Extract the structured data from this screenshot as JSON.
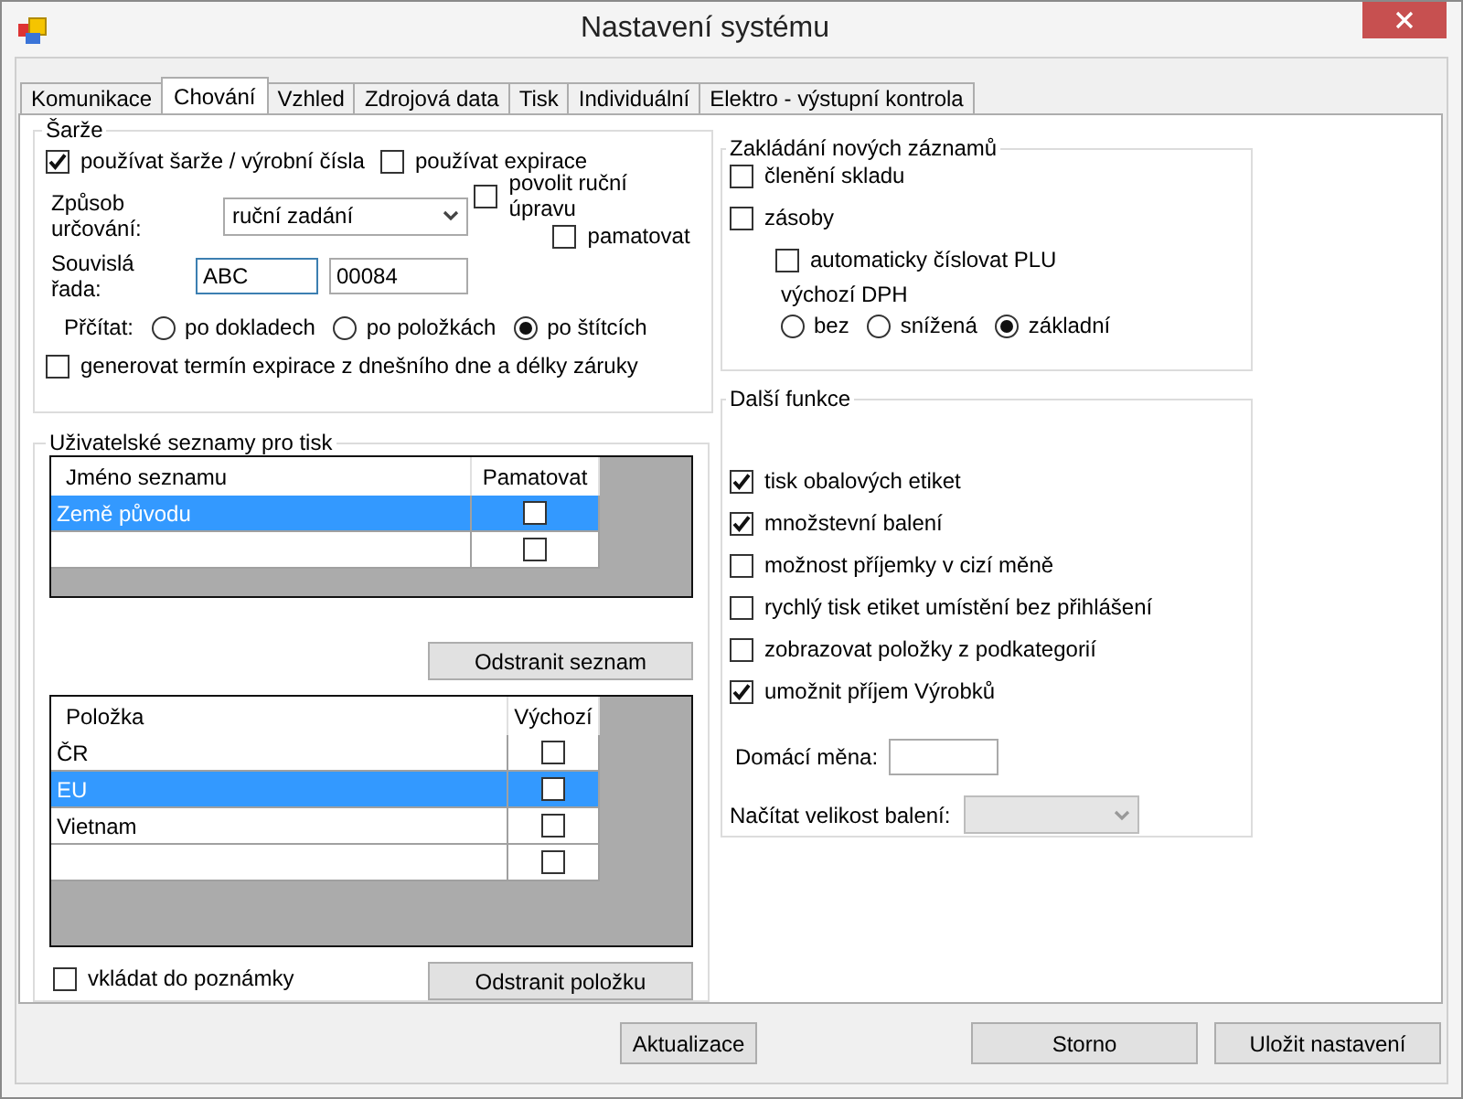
{
  "window": {
    "title": "Nastavení systému"
  },
  "tabs": [
    {
      "label": "Komunikace",
      "selected": false
    },
    {
      "label": "Chování",
      "selected": true
    },
    {
      "label": "Vzhled",
      "selected": false
    },
    {
      "label": "Zdrojová data",
      "selected": false
    },
    {
      "label": "Tisk",
      "selected": false
    },
    {
      "label": "Individuální",
      "selected": false
    },
    {
      "label": "Elektro - výstupní kontrola",
      "selected": false
    }
  ],
  "batches": {
    "title": "Šarže",
    "use_batches": {
      "label": "používat šarže / výrobní čísla",
      "checked": true
    },
    "use_expiry": {
      "label": "používat expirace",
      "checked": false
    },
    "allow_manual_edit": {
      "label": "povolit ruční úpravu",
      "checked": false
    },
    "remember": {
      "label": "pamatovat",
      "checked": false
    },
    "method": {
      "label": "Způsob určování:",
      "value": "ruční zadání"
    },
    "series": {
      "label": "Souvislá řada:",
      "prefix": "ABC",
      "number": "00084"
    },
    "count": {
      "label": "Přčítat:",
      "options": [
        {
          "label": "po dokladech",
          "selected": false
        },
        {
          "label": "po položkách",
          "selected": false
        },
        {
          "label": "po štítcích",
          "selected": true
        }
      ]
    },
    "generate_expiry": {
      "label": "generovat termín expirace z dnešního dne a délky záruky",
      "checked": false
    }
  },
  "user_lists": {
    "title": "Uživatelské seznamy pro tisk",
    "lists_table": {
      "columns": [
        "Jméno seznamu",
        "Pamatovat"
      ],
      "rows": [
        {
          "name": "Země původu",
          "checked": false,
          "selected": true
        },
        {
          "checked": false,
          "selected": false
        }
      ]
    },
    "remove_list_button": "Odstranit seznam",
    "items_table": {
      "columns": [
        "Položka",
        "Výchozí"
      ],
      "rows": [
        {
          "name": "ČR",
          "checked": false,
          "selected": false
        },
        {
          "name": "EU",
          "checked": false,
          "selected": true
        },
        {
          "name": "Vietnam",
          "checked": false,
          "selected": false
        },
        {
          "checked": false,
          "selected": false
        }
      ]
    },
    "insert_note": {
      "label": "vkládat do poznámky",
      "checked": false
    },
    "remove_item_button": "Odstranit položku"
  },
  "new_records": {
    "title": "Zakládání nových záznamů",
    "options": [
      {
        "label": "členění skladu",
        "checked": false
      },
      {
        "label": "zásoby",
        "checked": false
      }
    ],
    "auto_plu": {
      "label": "automaticky číslovat PLU",
      "checked": false
    },
    "vat": {
      "label": "výchozí DPH",
      "options": [
        {
          "label": "bez",
          "selected": false
        },
        {
          "label": "snížená",
          "selected": false
        },
        {
          "label": "základní",
          "selected": true
        }
      ]
    }
  },
  "more_functions": {
    "title": "Další funkce",
    "options": [
      {
        "label": "tisk obalových etiket",
        "checked": true
      },
      {
        "label": "množstevní balení",
        "checked": true
      },
      {
        "label": "možnost příjemky v cizí měně",
        "checked": false
      },
      {
        "label": "rychlý tisk etiket umístění bez přihlášení",
        "checked": false
      },
      {
        "label": "zobrazovat položky z podkategorií",
        "checked": false
      },
      {
        "label": "umožnit příjem Výrobků",
        "checked": true
      }
    ],
    "home_currency": {
      "label": "Domácí měna:"
    },
    "package_size": {
      "label": "Načítat velikost balení:",
      "disabled": true
    }
  },
  "footer": {
    "refresh_button": "Aktualizace",
    "cancel_button": "Storno",
    "save_button": "Uložit nastavení"
  }
}
